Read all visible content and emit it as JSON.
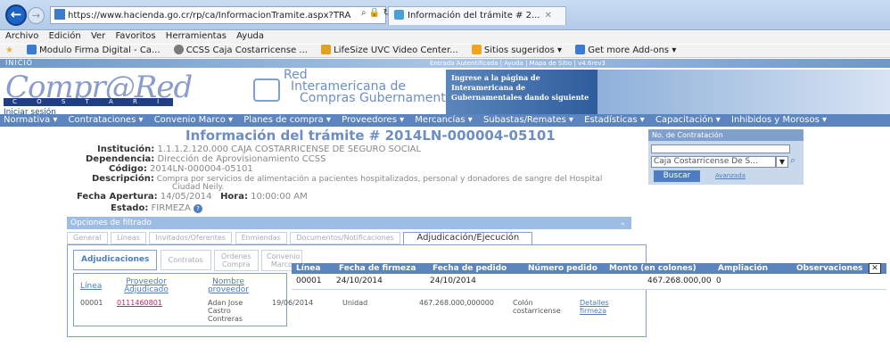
{
  "browser": {
    "url": "https://www.hacienda.go.cr/rp/ca/InformacionTramite.aspx?TRA",
    "url_domain": "hacienda.go.cr",
    "tab_title": "Información del trámite # 2...",
    "menu": [
      "Archivo",
      "Edición",
      "Ver",
      "Favoritos",
      "Herramientas",
      "Ayuda"
    ],
    "favorites": [
      {
        "label": "Modulo Firma Digital - Ca...",
        "color": "#3a7bd5"
      },
      {
        "label": "CCSS Caja Costarricense ...",
        "color": "#7a7a7a"
      },
      {
        "label": "LifeSize UVC Video Center...",
        "color": "#e0a020"
      },
      {
        "label": "Sitios sugeridos ▾",
        "color": "#f2a51a"
      },
      {
        "label": "Get more Add-ons ▾",
        "color": "#3a7bd5"
      }
    ]
  },
  "header": {
    "inicio": "INICIO",
    "auth_links": "Entrada Autentificada | Ayuda | Mapa de Sitio | v4.6rev3",
    "logo": "Compr@Red",
    "logo_country": "C O S T A R I C A",
    "iniciar_sesion": "Iniciar sesión",
    "ria_line1": "Red",
    "ria_line2": "Interamericana de",
    "ria_line3": "Compras Gubernamentales",
    "ria_promo": "Ingrese a la página de Interamericana de Gubernamentales dando siguiente"
  },
  "nav": [
    "Normativa ▾",
    "Contrataciones ▾",
    "Convenio Marco ▾",
    "Planes de compra ▾",
    "Proveedores ▾",
    "Mercancías ▾",
    "Subastas/Remates ▾",
    "Estadísticas ▾",
    "Capacitación ▾",
    "Inhibidos y Morosos ▾"
  ],
  "page": {
    "title": "Información del trámite # 2014LN-000004-05101",
    "fields": [
      {
        "label": "Institución:",
        "value": "1.1.1.2.120.000   CAJA COSTARRICENSE DE SEGURO SOCIAL"
      },
      {
        "label": "Dependencia:",
        "value": "Dirección de Aprovisionamiento CCSS"
      },
      {
        "label": "Código:",
        "value": "2014LN-000004-05101"
      },
      {
        "label": "Descripción:",
        "value": "Compra por servicios de alimentación a pacientes hospitalizados, personal y donadores de sangre del Hospital",
        "value2": "Ciudad Neily."
      },
      {
        "label": "Fecha Apertura:",
        "value": "14/05/2014",
        "label2": "Hora:",
        "value3": "10:00:00 AM"
      },
      {
        "label": "Estado:",
        "value": "FIRMEZA"
      }
    ]
  },
  "search": {
    "header": "No. de Contratación",
    "select": "Caja Costarricense De S...",
    "button": "Buscar",
    "advanced": "Avanzada"
  },
  "filter": {
    "title": "Opciones de filtrado",
    "tabs": [
      "General",
      "Líneas",
      "Invitados/Oferentes",
      "Enmiendas",
      "Documentos/Notificaciones",
      "Adjudicación/Ejecución"
    ],
    "sub_tabs": [
      "Adjudicaciones",
      "Contratos",
      "Órdenes Compra",
      "Convenio Marco"
    ]
  },
  "table": {
    "headers": [
      "Línea",
      "Proveedor Adjudicado",
      "Nombre proveedor"
    ],
    "row": {
      "linea": "00001",
      "proveedor": "0111460801",
      "nombre": "Adan Jose Castro Contreras",
      "fecha": "19/06/2014",
      "unidad": "Unidad",
      "monto": "467.268.000,000000",
      "moneda": "Colón costarricense",
      "detalles": "Detalles firmeza"
    }
  },
  "overlay": {
    "headers": [
      "Línea",
      "Fecha de firmeza",
      "Fecha de pedido",
      "Número pedido",
      "Monto (en colones)",
      "Ampliación",
      "Observaciones"
    ],
    "row": [
      "00001",
      "24/10/2014",
      "24/10/2014",
      "",
      "467.268.000,00",
      "0",
      ""
    ],
    "close": "✕"
  }
}
